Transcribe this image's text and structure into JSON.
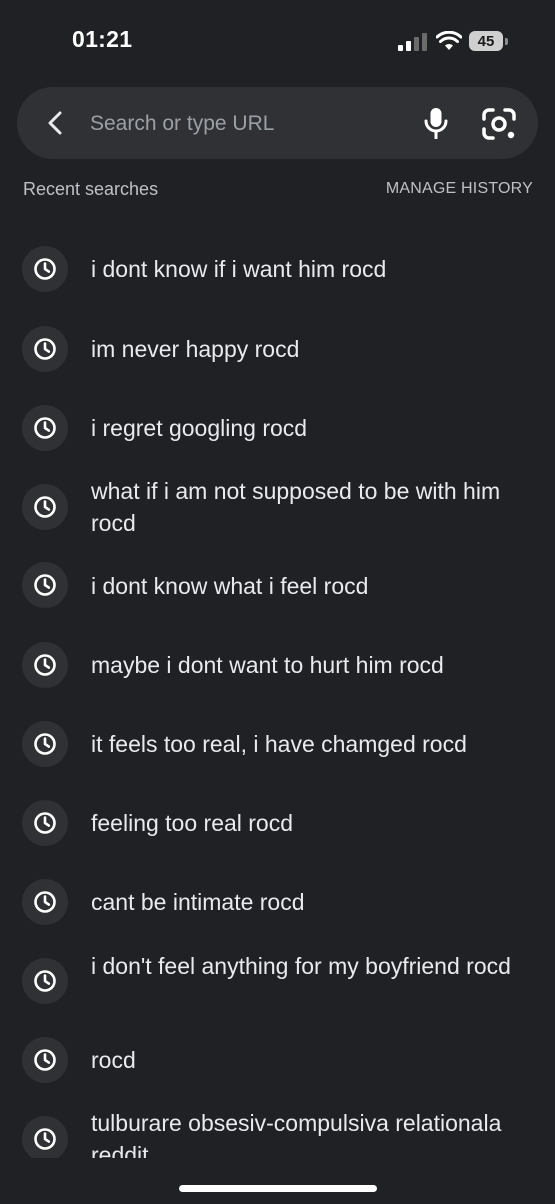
{
  "status_bar": {
    "time": "01:21",
    "battery": "45"
  },
  "search": {
    "placeholder": "Search or type URL"
  },
  "section": {
    "title": "Recent searches",
    "manage_label": "MANAGE HISTORY"
  },
  "history": [
    {
      "text": "i dont know if i want him rocd"
    },
    {
      "text": "im never happy rocd"
    },
    {
      "text": "i regret googling rocd"
    },
    {
      "text": "what if i am not supposed to be with him rocd"
    },
    {
      "text": "i dont know what i feel rocd"
    },
    {
      "text": "maybe i dont want to hurt him rocd"
    },
    {
      "text": "it feels too real, i have chamged rocd"
    },
    {
      "text": "feeling too real rocd"
    },
    {
      "text": "cant be intimate rocd"
    },
    {
      "text": "i don't feel anything for my boyfriend rocd"
    },
    {
      "text": "rocd"
    },
    {
      "text": "tulburare obsesiv-compulsiva relationala reddit"
    }
  ],
  "icons": {
    "back": "chevron-left-icon",
    "mic": "mic-icon",
    "lens": "lens-camera-icon",
    "history": "clock-icon"
  },
  "colors": {
    "background": "#202124",
    "search_bar": "#303134",
    "text": "#e8eaed",
    "secondary_text": "#bdc1c6"
  }
}
